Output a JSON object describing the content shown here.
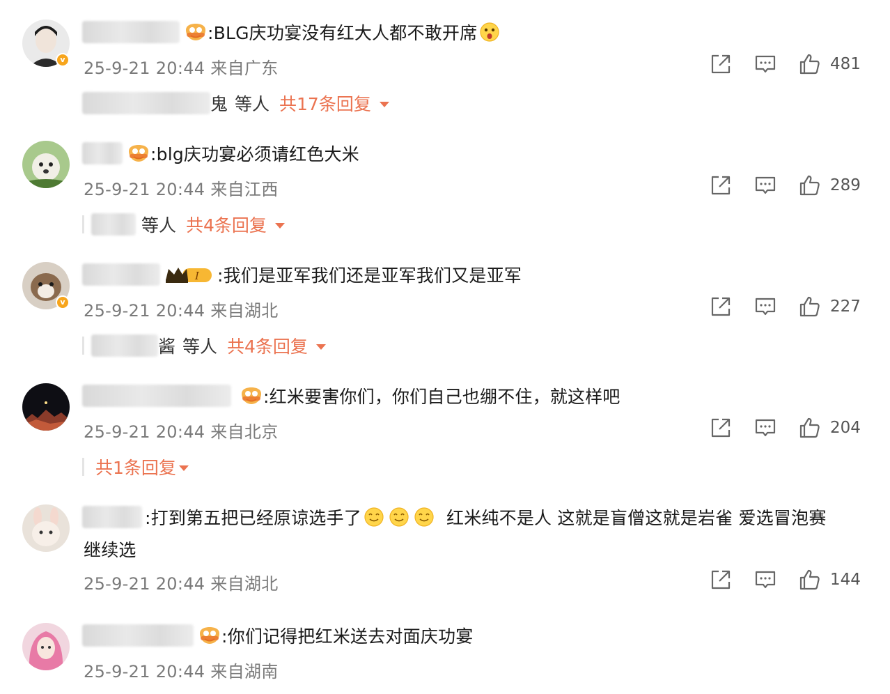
{
  "comments": [
    {
      "text": ":BLG庆功宴没有红大人都不敢开席",
      "meta": "25-9-21 20:44 来自广东",
      "likes": "481",
      "reply_who_tail": "鬼",
      "reply_who": "等人",
      "reply_count": "共17条回复",
      "verified": true
    },
    {
      "text": ":blg庆功宴必须请红色大米",
      "meta": "25-9-21 20:44 来自江西",
      "likes": "289",
      "reply_who": "等人",
      "reply_count": "共4条回复"
    },
    {
      "text": ":我们是亚军我们还是亚军我们又是亚军",
      "meta": "25-9-21 20:44 来自湖北",
      "likes": "227",
      "badge_level": "I",
      "reply_who_tail": "酱",
      "reply_who": "等人",
      "reply_count": "共4条回复",
      "verified": true
    },
    {
      "text": ":红米要害你们，你们自己也绷不住，就这样吧",
      "meta": "25-9-21 20:44 来自北京",
      "likes": "204",
      "reply_count": "共1条回复"
    },
    {
      "text_a": ":打到第五把已经原谅选手了",
      "text_b": "红米纯不是人 这就是盲僧这就是岩雀 爱选冒泡赛",
      "text_c": "继续选",
      "meta": "25-9-21 20:44 来自湖北",
      "likes": "144"
    },
    {
      "text": ":你们记得把红米送去对面庆功宴",
      "meta": "25-9-21 20:44 来自湖南"
    }
  ],
  "icons": {
    "share": "share-icon",
    "reply": "comment-icon",
    "like": "thumbs-up-icon",
    "fan": "fan-badge-icon",
    "expand": "caret-down-icon"
  },
  "colors": {
    "accent": "#eb7350",
    "meta": "#7a7a7a",
    "verified": "#f7a51c"
  }
}
